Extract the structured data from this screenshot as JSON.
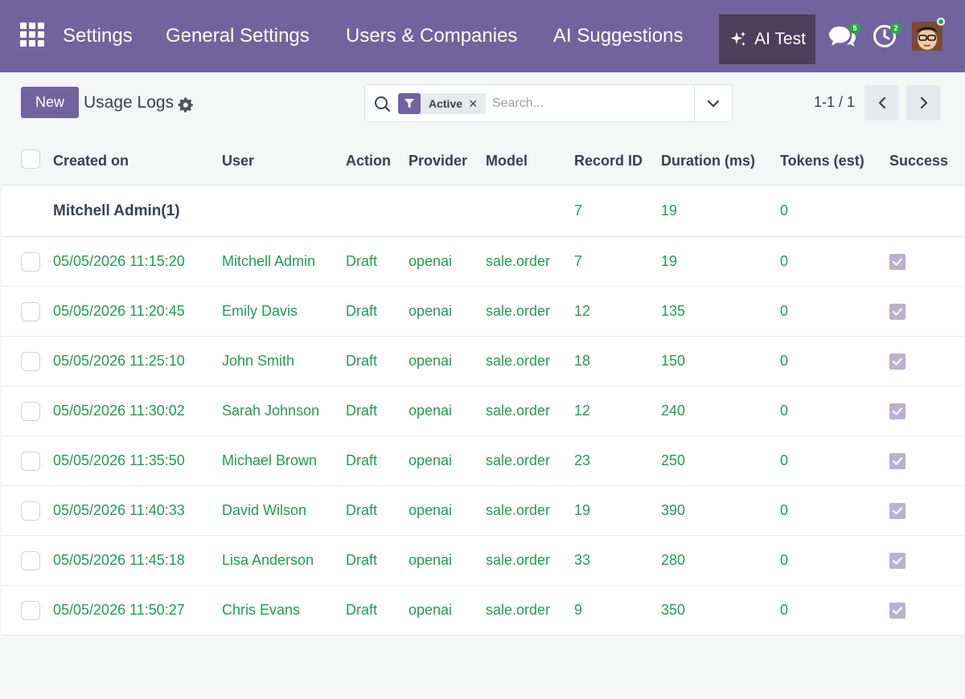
{
  "navbar": {
    "menu_items": [
      "Settings",
      "General Settings",
      "Users & Companies",
      "AI Suggestions"
    ],
    "ai_button_label": "AI Test",
    "messages_badge": "5",
    "activities_badge": "2",
    "brand_color": "#71639e"
  },
  "control_panel": {
    "new_label": "New",
    "breadcrumb": "Usage Logs",
    "search": {
      "facet_label": "Active",
      "placeholder": "Search..."
    },
    "pager": "1-1 / 1"
  },
  "table": {
    "columns": [
      "Created on",
      "User",
      "Action",
      "Provider",
      "Model",
      "Record ID",
      "Duration (ms)",
      "Tokens (est)",
      "Success"
    ],
    "group": {
      "label": "Mitchell Admin(1)",
      "record_id": "7",
      "duration": "19",
      "tokens": "0"
    },
    "rows": [
      {
        "created": "05/05/2026 11:15:20",
        "user": "Mitchell Admin",
        "action": "Draft",
        "provider": "openai",
        "model": "sale.order",
        "record_id": "7",
        "duration": "19",
        "tokens": "0",
        "success": true
      },
      {
        "created": "05/05/2026 11:20:45",
        "user": "Emily Davis",
        "action": "Draft",
        "provider": "openai",
        "model": "sale.order",
        "record_id": "12",
        "duration": "135",
        "tokens": "0",
        "success": true
      },
      {
        "created": "05/05/2026 11:25:10",
        "user": "John Smith",
        "action": "Draft",
        "provider": "openai",
        "model": "sale.order",
        "record_id": "18",
        "duration": "150",
        "tokens": "0",
        "success": true
      },
      {
        "created": "05/05/2026 11:30:02",
        "user": "Sarah Johnson",
        "action": "Draft",
        "provider": "openai",
        "model": "sale.order",
        "record_id": "12",
        "duration": "240",
        "tokens": "0",
        "success": true
      },
      {
        "created": "05/05/2026 11:35:50",
        "user": "Michael Brown",
        "action": "Draft",
        "provider": "openai",
        "model": "sale.order",
        "record_id": "23",
        "duration": "250",
        "tokens": "0",
        "success": true
      },
      {
        "created": "05/05/2026 11:40:33",
        "user": "David Wilson",
        "action": "Draft",
        "provider": "openai",
        "model": "sale.order",
        "record_id": "19",
        "duration": "390",
        "tokens": "0",
        "success": true
      },
      {
        "created": "05/05/2026 11:45:18",
        "user": "Lisa Anderson",
        "action": "Draft",
        "provider": "openai",
        "model": "sale.order",
        "record_id": "33",
        "duration": "280",
        "tokens": "0",
        "success": true
      },
      {
        "created": "05/05/2026 11:50:27",
        "user": "Chris Evans",
        "action": "Draft",
        "provider": "openai",
        "model": "sale.order",
        "record_id": "9",
        "duration": "350",
        "tokens": "0",
        "success": true
      }
    ]
  }
}
